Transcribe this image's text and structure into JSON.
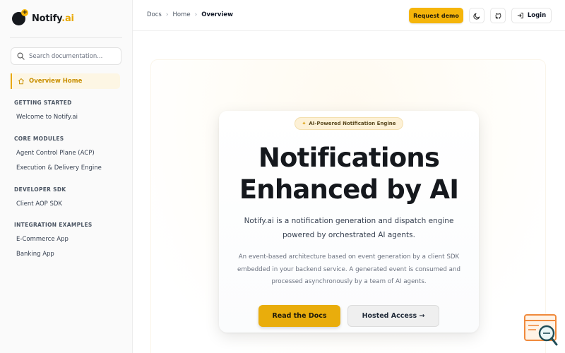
{
  "brand": {
    "name_main": "Notify",
    "name_suffix": ".ai",
    "accent": "#f5b50a"
  },
  "sidebar": {
    "search_placeholder": "Search documentation...",
    "active_item": "Overview Home",
    "groups": [
      {
        "title": "GETTING STARTED",
        "items": [
          "Welcome to Notify.ai"
        ]
      },
      {
        "title": "CORE MODULES",
        "items": [
          "Agent Control Plane (ACP)",
          "Execution & Delivery Engine"
        ]
      },
      {
        "title": "DEVELOPER SDK",
        "items": [
          "Client AOP SDK"
        ]
      },
      {
        "title": "INTEGRATION EXAMPLES",
        "items": [
          "E-Commerce App",
          "Banking App"
        ]
      }
    ]
  },
  "topbar": {
    "breadcrumb": [
      "Docs",
      "Home",
      "Overview"
    ],
    "request_demo": "Request demo",
    "theme_icon": "moon-icon",
    "github_icon": "github-icon",
    "login": "Login"
  },
  "hero": {
    "badge": "AI-Powered Notification Engine",
    "badge_icon": "✦",
    "title_line1": "Notifications",
    "title_line2": "Enhanced by AI",
    "lead": "Notify.ai is a notification generation and dispatch engine powered by orchestrated AI agents.",
    "body": "An event-based architecture based on event generation by a client SDK embedded in your backend service. A generated event is consumed and processed asynchronously by a team of AI agents.",
    "primary_cta": "Read the Docs",
    "secondary_cta": "Hosted Access →"
  }
}
